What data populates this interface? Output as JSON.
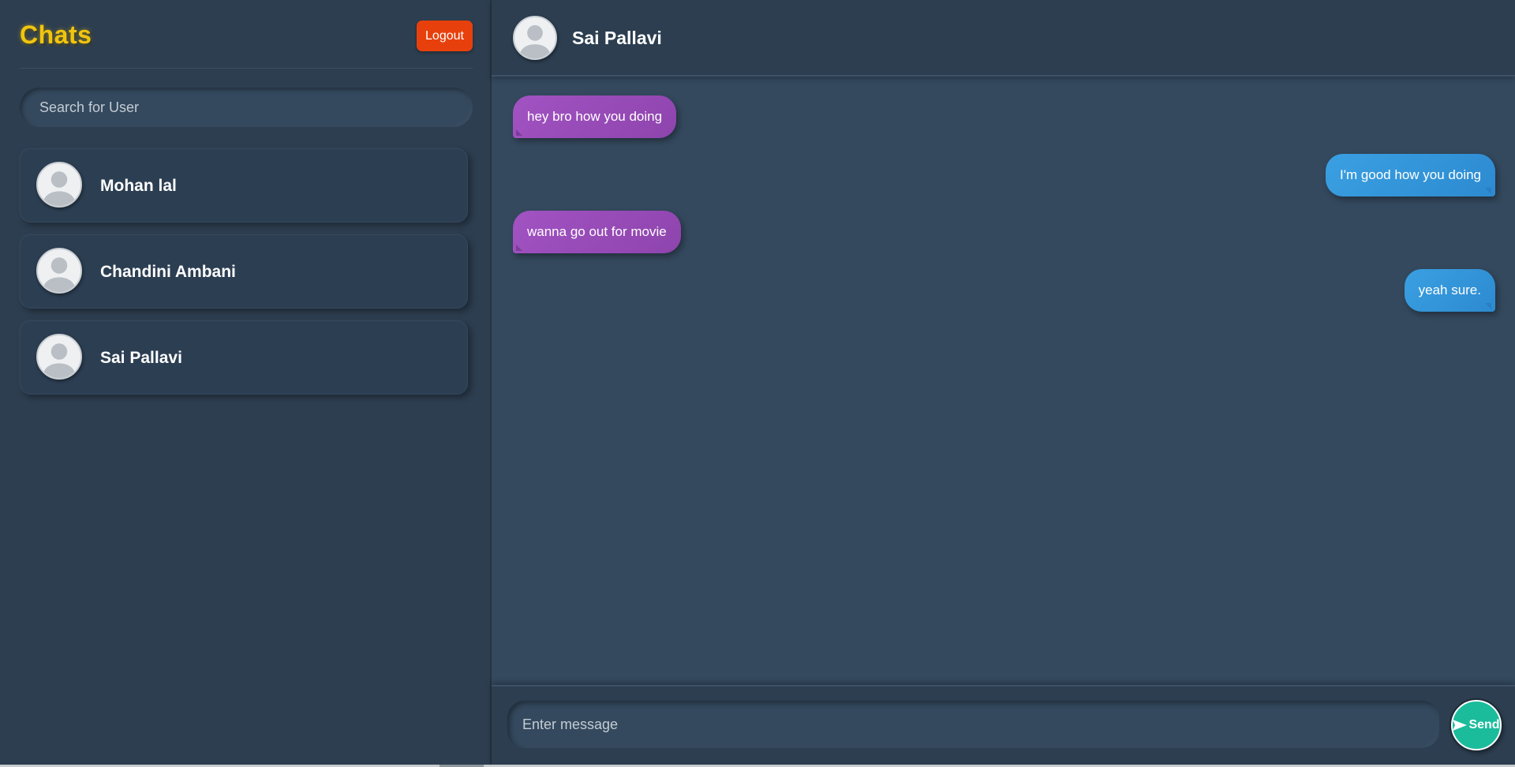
{
  "sidebar": {
    "title": "Chats",
    "logout_label": "Logout",
    "search_placeholder": "Search for User",
    "users": [
      {
        "name": "Mohan lal"
      },
      {
        "name": "Chandini Ambani"
      },
      {
        "name": "Sai Pallavi"
      }
    ]
  },
  "chat": {
    "title": "Sai Pallavi",
    "messages": [
      {
        "text": "hey bro how you doing",
        "direction": "incoming"
      },
      {
        "text": "I'm good how you doing",
        "direction": "outgoing"
      },
      {
        "text": "wanna go out for movie",
        "direction": "incoming"
      },
      {
        "text": "yeah sure.",
        "direction": "outgoing"
      }
    ],
    "composer": {
      "placeholder": "Enter message",
      "send_label": "Send",
      "send_icon": "send-arrow-icon"
    }
  },
  "colors": {
    "sidebar_bg": "#2d3e50",
    "chat_bg": "#34495e",
    "title_accent": "#f1c40f",
    "logout_bg": "#e8400c",
    "incoming_bubble": "#9b59b6",
    "outgoing_bubble": "#3498db",
    "send_bg": "#1abc9c"
  },
  "icons": {
    "avatar": "user-avatar-icon"
  }
}
